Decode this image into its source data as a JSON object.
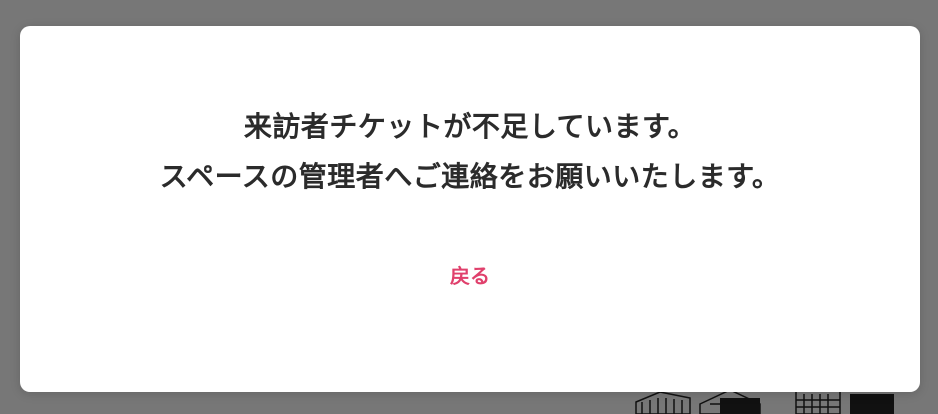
{
  "dialog": {
    "message_line1": "来訪者チケットが不足しています。",
    "message_line2": "スペースの管理者へご連絡をお願いいたします。",
    "back_label": "戻る"
  },
  "colors": {
    "backdrop": "#777777",
    "dialog_background": "#ffffff",
    "text": "#2b2b2b",
    "accent": "#e0406c"
  }
}
